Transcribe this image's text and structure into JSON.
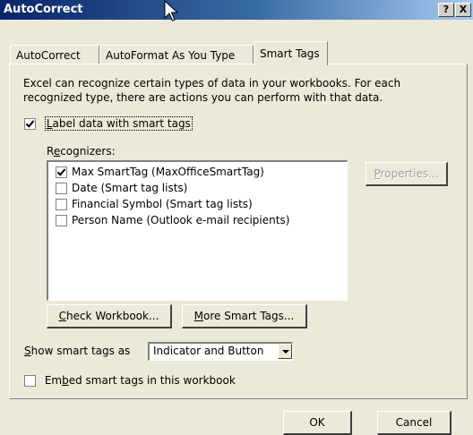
{
  "window": {
    "title": "AutoCorrect",
    "help_label": "?",
    "close_label": "X"
  },
  "tabs": [
    {
      "label": "AutoCorrect",
      "active": false
    },
    {
      "label": "AutoFormat As You Type",
      "active": false
    },
    {
      "label": "Smart Tags",
      "active": true
    }
  ],
  "intro_text": "Excel can recognize certain types of data in your workbooks.  For each recognized type, there are actions you can perform with that data.",
  "label_checkbox": {
    "underlined": "L",
    "label_rest": "abel data with smart tags",
    "checked": true
  },
  "recognizers": {
    "heading_pre": "R",
    "heading_underlined": "e",
    "heading_post": "cognizers:",
    "items": [
      {
        "label": "Max SmartTag (MaxOfficeSmartTag)",
        "checked": true
      },
      {
        "label": "Date (Smart tag lists)",
        "checked": false
      },
      {
        "label": "Financial Symbol (Smart tag lists)",
        "checked": false
      },
      {
        "label": "Person Name (Outlook e-mail recipients)",
        "checked": false
      }
    ]
  },
  "buttons": {
    "properties_underlined": "P",
    "properties_rest": "roperties...",
    "check_workbook_underlined": "C",
    "check_workbook_rest": "heck Workbook...",
    "more_smart_tags_underlined": "M",
    "more_smart_tags_rest": "ore Smart Tags...",
    "ok": "OK",
    "cancel": "Cancel"
  },
  "show_as": {
    "underlined": "S",
    "label_rest": "how smart tags as",
    "selected": "Indicator and Button"
  },
  "embed_checkbox": {
    "pre": "Em",
    "underlined": "b",
    "post": "ed smart tags in this workbook",
    "checked": false
  }
}
